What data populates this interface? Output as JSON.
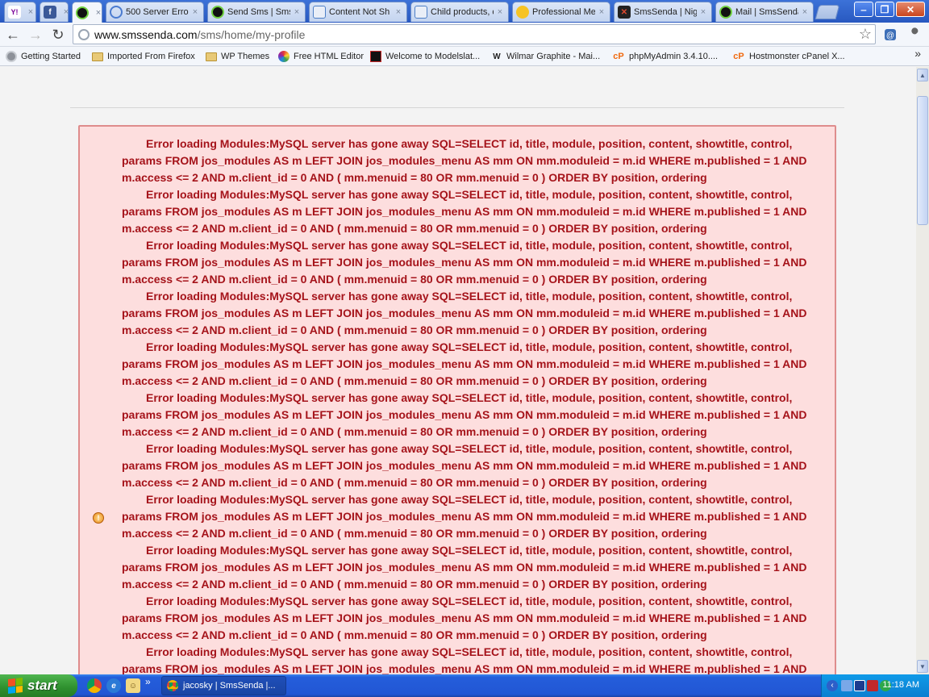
{
  "browser": {
    "tabs": [
      {
        "label": "",
        "icon": "yahoo-icon",
        "active": false
      },
      {
        "label": "",
        "icon": "facebook-icon",
        "active": false
      },
      {
        "label": "",
        "icon": "smssenda-icon",
        "active": true
      },
      {
        "label": "500 Server Erro",
        "icon": "loading-icon",
        "active": false
      },
      {
        "label": "Send Sms | Sms",
        "icon": "smssenda-icon",
        "active": false
      },
      {
        "label": "Content Not Sh",
        "icon": "wordpress-icon",
        "active": false
      },
      {
        "label": "Child products, c",
        "icon": "wordpress-icon",
        "active": false
      },
      {
        "label": "Professional Me",
        "icon": "smiley-icon",
        "active": false
      },
      {
        "label": "SmsSenda | Nig",
        "icon": "joomla-icon",
        "active": false
      },
      {
        "label": "Mail | SmsSenda",
        "icon": "smssenda-icon",
        "active": false
      }
    ],
    "close_glyph": "×",
    "window_controls": {
      "minimize": "‒",
      "maximize": "❐",
      "close": "✕"
    },
    "url_host": "www.smssenda.com",
    "url_path": "/sms/home/my-profile",
    "bookmarks": [
      {
        "label": "Getting Started",
        "icon": "chrome-icon"
      },
      {
        "label": "Imported From Firefox",
        "icon": "folder-icon"
      },
      {
        "label": "WP Themes",
        "icon": "folder-icon"
      },
      {
        "label": "Free HTML Editor",
        "icon": "color-wheel-icon"
      },
      {
        "label": "Welcome to Modelslat...",
        "icon": "modelslat-icon"
      },
      {
        "label": "Wilmar Graphite - Mai...",
        "icon": "wilmar-icon"
      },
      {
        "label": "phpMyAdmin 3.4.10....",
        "icon": "cpanel-icon"
      },
      {
        "label": "Hostmonster cPanel X...",
        "icon": "cpanel-icon"
      }
    ],
    "bookmarks_overflow": "»",
    "cpanel_glyph": "cP"
  },
  "page": {
    "error_text": "Error loading Modules:MySQL server has gone away SQL=SELECT id, title, module, position, content, showtitle, control, params FROM jos_modules AS m LEFT JOIN jos_modules_menu AS mm ON mm.moduleid = m.id WHERE m.published = 1 AND m.access <= 2 AND m.client_id = 0 AND ( mm.menuid = 80 OR mm.menuid = 0 ) ORDER BY position, ordering",
    "error_repeat_count": 11,
    "colors": {
      "error_bg": "#fddede",
      "error_border": "#de8c8c",
      "error_text": "#a5131a"
    }
  },
  "taskbar": {
    "start_label": "start",
    "quick_overflow": "»",
    "task_label": "jacosky | SmsSenda |...",
    "clock": "11:18 AM"
  }
}
